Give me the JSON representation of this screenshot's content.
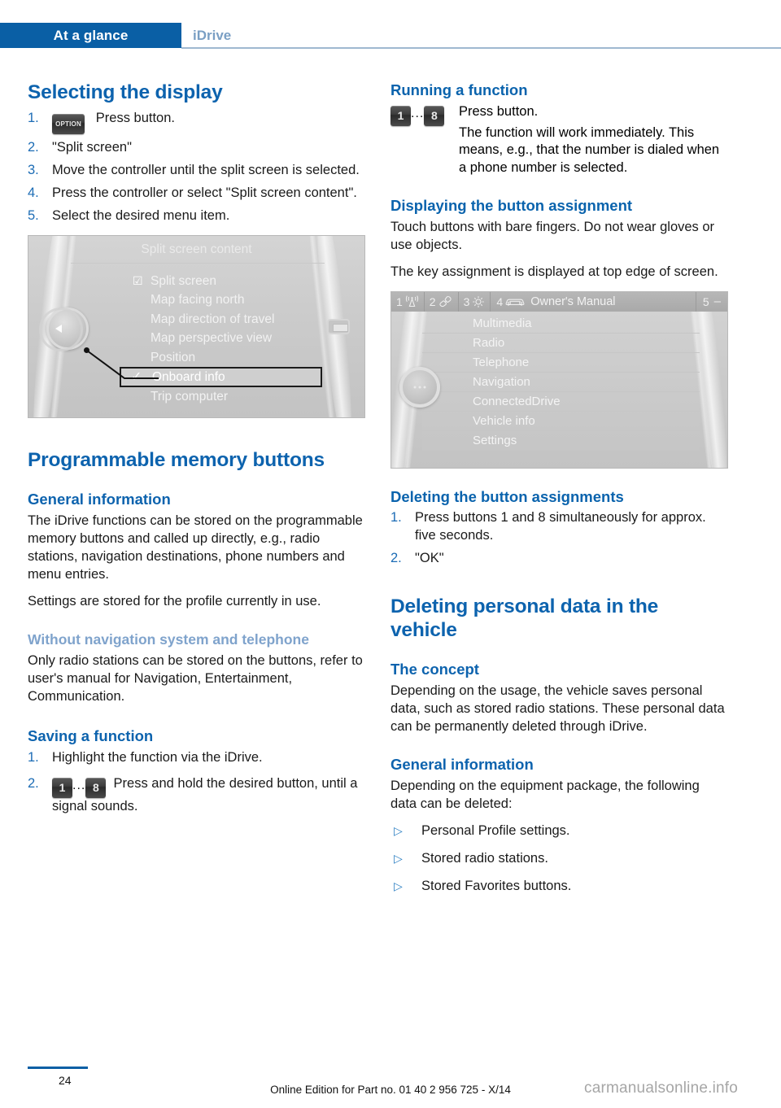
{
  "header": {
    "tab_label": "At a glance",
    "section_label": "iDrive"
  },
  "left_column": {
    "heading_selecting": "Selecting the display",
    "steps_selecting": [
      {
        "num": "1.",
        "icon": "option-button",
        "text": "Press button."
      },
      {
        "num": "2.",
        "text": "\"Split screen\""
      },
      {
        "num": "3.",
        "text": "Move the controller until the split screen is selected."
      },
      {
        "num": "4.",
        "text": "Press the controller or select \"Split screen content\"."
      },
      {
        "num": "5.",
        "text": "Select the desired menu item."
      }
    ],
    "option_button_label": "OPTION",
    "screen_split": {
      "title": "Split screen content",
      "items": [
        {
          "label": "Split screen",
          "mark": "checkbox-checked",
          "highlighted": false
        },
        {
          "label": "Map facing north",
          "mark": "",
          "highlighted": false
        },
        {
          "label": "Map direction of travel",
          "mark": "",
          "highlighted": false
        },
        {
          "label": "Map perspective view",
          "mark": "",
          "highlighted": false
        },
        {
          "label": "Position",
          "mark": "",
          "highlighted": false
        },
        {
          "label": "Onboard info",
          "mark": "checkmark",
          "highlighted": true
        },
        {
          "label": "Trip computer",
          "mark": "",
          "highlighted": false
        }
      ]
    },
    "heading_programmable": "Programmable memory buttons",
    "heading_general_info": "General information",
    "para_general_1": "The iDrive functions can be stored on the programmable memory buttons and called up directly, e.g., radio stations, navigation destinations, phone numbers and menu entries.",
    "para_general_2": "Settings are stored for the profile currently in use.",
    "heading_without_nav": "Without navigation system and telephone",
    "para_without_nav": "Only radio stations can be stored on the buttons, refer to user's manual for Navigation, Entertainment, Communication.",
    "heading_saving": "Saving a function",
    "steps_saving": [
      {
        "num": "1.",
        "text": "Highlight the function via the iDrive."
      },
      {
        "num": "2.",
        "icon": "key-1-8",
        "text": "Press and hold the desired button, until a signal sounds."
      }
    ]
  },
  "right_column": {
    "heading_running": "Running a function",
    "running_press": "Press button.",
    "running_detail": "The function will work immediately. This means, e.g., that the number is dialed when a phone number is selected.",
    "heading_displaying": "Displaying the button assignment",
    "para_displaying_1": "Touch buttons with bare fingers. Do not wear gloves or use objects.",
    "para_displaying_2": "The key assignment is displayed at top edge of screen.",
    "screen_assignment": {
      "slots": [
        {
          "num": "1",
          "icon": "antenna-icon",
          "label": ""
        },
        {
          "num": "2",
          "icon": "phone-icon",
          "label": ""
        },
        {
          "num": "3",
          "icon": "gear-icon",
          "label": ""
        },
        {
          "num": "4",
          "icon": "car-icon",
          "label": "Owner's Manual"
        },
        {
          "num": "5",
          "icon": "dash-icon",
          "label": ""
        }
      ],
      "items": [
        "Multimedia",
        "Radio",
        "Telephone",
        "Navigation",
        "ConnectedDrive",
        "Vehicle info",
        "Settings"
      ]
    },
    "heading_deleting_assign": "Deleting the button assignments",
    "steps_deleting": [
      {
        "num": "1.",
        "text": "Press buttons 1 and 8 simultaneously for approx. five seconds."
      },
      {
        "num": "2.",
        "text": "\"OK\""
      }
    ],
    "heading_deleting_personal": "Deleting personal data in the vehicle",
    "heading_concept": "The concept",
    "para_concept": "Depending on the usage, the vehicle saves personal data, such as stored radio stations. These personal data can be permanently deleted through iDrive.",
    "heading_general_info_2": "General information",
    "para_general_2": "Depending on the equipment package, the following data can be deleted:",
    "bullets": [
      "Personal Profile settings.",
      "Stored radio stations.",
      "Stored Favorites buttons."
    ],
    "bullet_marker": "▷"
  },
  "keys": {
    "first": "1",
    "last": "8",
    "ellipsis": "..."
  },
  "footer": {
    "page_number": "24",
    "edition_text": "Online Edition for Part no. 01 40 2 956 725 - X/14",
    "watermark": "carmanualsonline.info"
  },
  "colors": {
    "header_blue": "#0a5fa5",
    "heading_blue": "#0d63ae",
    "muted_blue": "#7fa3cc",
    "number_blue": "#1c6cb5"
  }
}
